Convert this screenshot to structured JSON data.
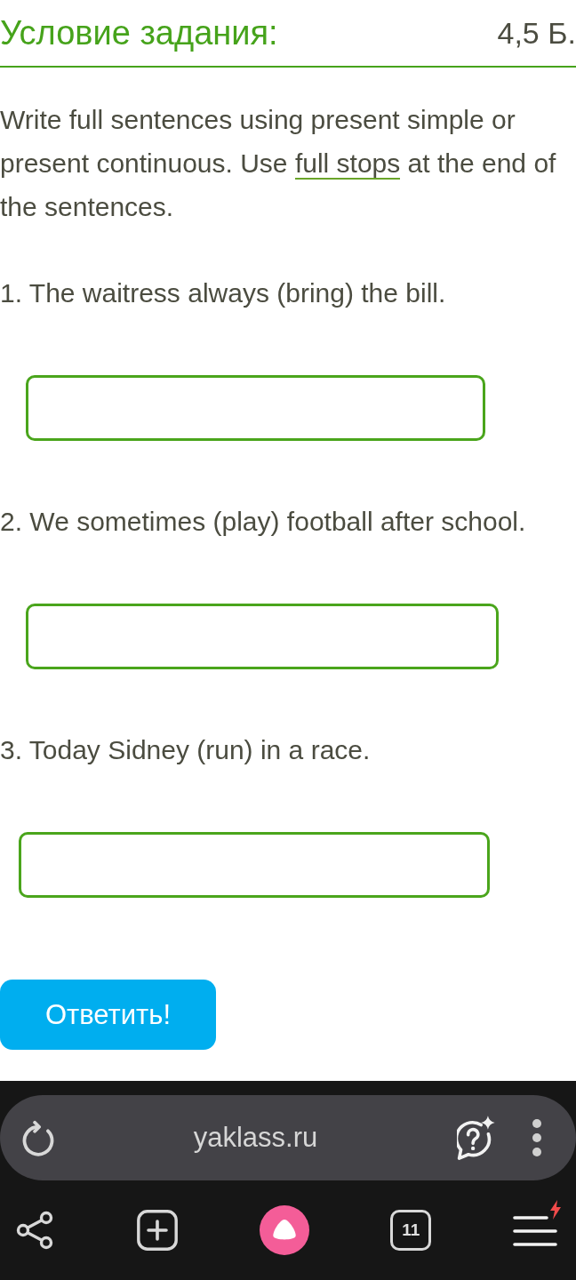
{
  "task": {
    "title": "Условие задания:",
    "points": "4,5 Б."
  },
  "instruction": {
    "before": "Write full sentences using present simple or present continuous. Use ",
    "term": "full stops",
    "after": " at the end of the sentences."
  },
  "exercises": [
    {
      "text": "1. The waitress always (bring) the bill."
    },
    {
      "text": "2. We sometimes (play) football after school."
    },
    {
      "text": "3. Today Sidney (run) in a race."
    }
  ],
  "submit_button": {
    "label": "Ответить!"
  },
  "browser": {
    "url": "yaklass.ru",
    "tab_count": "11"
  }
}
